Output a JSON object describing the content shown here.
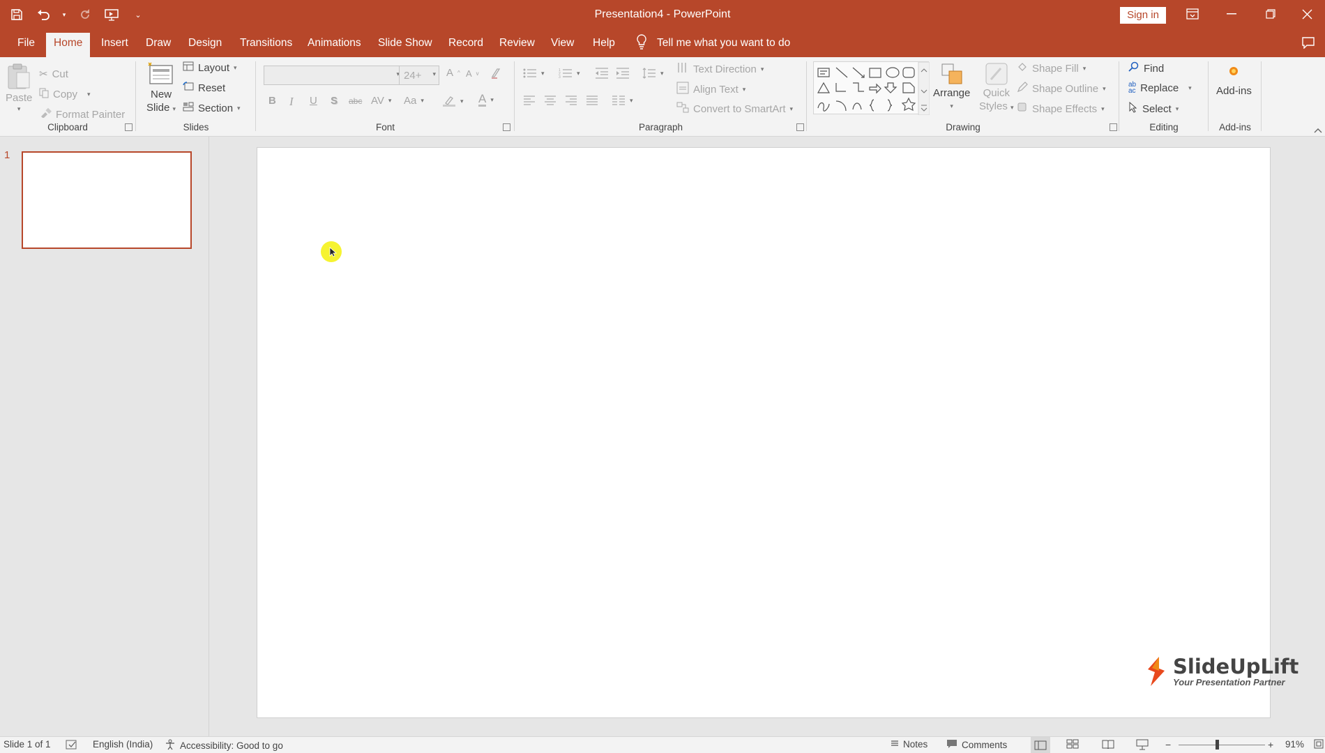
{
  "window": {
    "title": "Presentation4  -  PowerPoint",
    "sign_in": "Sign in"
  },
  "tabs": [
    "File",
    "Home",
    "Insert",
    "Draw",
    "Design",
    "Transitions",
    "Animations",
    "Slide Show",
    "Record",
    "Review",
    "View",
    "Help"
  ],
  "active_tab": "Home",
  "tell_me": "Tell me what you want to do",
  "ribbon": {
    "clipboard": {
      "label": "Clipboard",
      "paste": "Paste",
      "cut": "Cut",
      "copy": "Copy",
      "format_painter": "Format Painter"
    },
    "slides": {
      "label": "Slides",
      "new_slide_line1": "New",
      "new_slide_line2": "Slide",
      "layout": "Layout",
      "reset": "Reset",
      "section": "Section"
    },
    "font": {
      "label": "Font",
      "font_name": "",
      "font_size": "24+"
    },
    "paragraph": {
      "label": "Paragraph",
      "text_direction": "Text Direction",
      "align_text": "Align Text",
      "convert_smartart": "Convert to SmartArt"
    },
    "drawing": {
      "label": "Drawing",
      "arrange": "Arrange",
      "quick_styles_line1": "Quick",
      "quick_styles_line2": "Styles",
      "shape_fill": "Shape Fill",
      "shape_outline": "Shape Outline",
      "shape_effects": "Shape Effects"
    },
    "editing": {
      "label": "Editing",
      "find": "Find",
      "replace": "Replace",
      "select": "Select"
    },
    "addins": {
      "label": "Add-ins",
      "button": "Add-ins"
    }
  },
  "slide_panel": {
    "slide_number": "1"
  },
  "logo": {
    "brand": "SlideUpLift",
    "tagline": "Your Presentation Partner"
  },
  "status": {
    "slide_of": "Slide 1 of 1",
    "language": "English (India)",
    "accessibility": "Accessibility: Good to go",
    "notes": "Notes",
    "comments": "Comments",
    "zoom": "91%"
  },
  "colors": {
    "accent": "#b7472a",
    "ribbon_bg": "#f3f3f3",
    "workspace_bg": "#e6e6e6"
  }
}
